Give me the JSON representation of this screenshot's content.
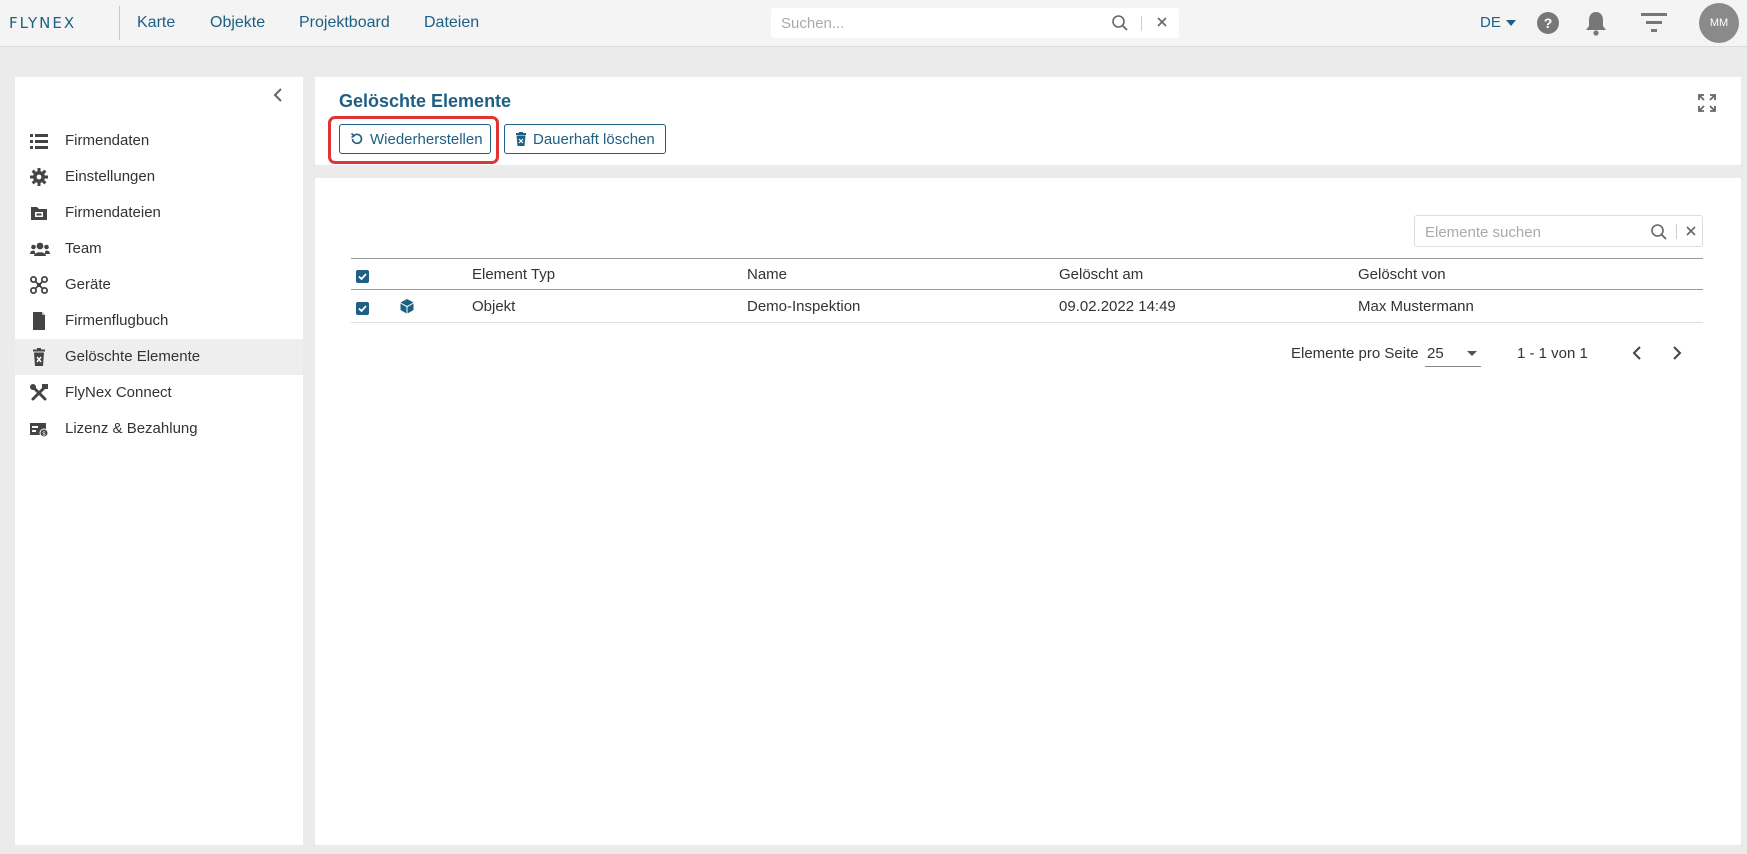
{
  "app": {
    "logo": "FLYNEX"
  },
  "nav": {
    "items": [
      "Karte",
      "Objekte",
      "Projektboard",
      "Dateien"
    ]
  },
  "topsearch": {
    "placeholder": "Suchen..."
  },
  "header_right": {
    "lang": "DE",
    "help": "?",
    "avatar_initials": "MM"
  },
  "sidebar": {
    "items": [
      {
        "label": "Firmendaten",
        "icon": "list-icon"
      },
      {
        "label": "Einstellungen",
        "icon": "gear-icon"
      },
      {
        "label": "Firmendateien",
        "icon": "folder-icon"
      },
      {
        "label": "Team",
        "icon": "team-icon"
      },
      {
        "label": "Geräte",
        "icon": "drone-icon"
      },
      {
        "label": "Firmenflugbuch",
        "icon": "book-icon"
      },
      {
        "label": "Gelöschte Elemente",
        "icon": "trash-icon",
        "active": true
      },
      {
        "label": "FlyNex Connect",
        "icon": "tools-icon"
      },
      {
        "label": "Lizenz & Bezahlung",
        "icon": "license-icon"
      }
    ]
  },
  "page": {
    "title": "Gelöschte Elemente",
    "restore_label": "Wiederherstellen",
    "delete_label": "Dauerhaft löschen"
  },
  "table": {
    "search_placeholder": "Elemente suchen",
    "columns": [
      "Element Typ",
      "Name",
      "Gelöscht am",
      "Gelöscht von"
    ],
    "rows": [
      {
        "type": "Objekt",
        "name": "Demo-Inspektion",
        "deleted_at": "09.02.2022 14:49",
        "deleted_by": "Max Mustermann",
        "checked": true
      }
    ]
  },
  "pagination": {
    "per_page_label": "Elemente pro Seite",
    "per_page_value": "25",
    "range": "1 - 1 von 1"
  },
  "colors": {
    "brand": "#1e5f84",
    "highlight": "#e03333"
  }
}
